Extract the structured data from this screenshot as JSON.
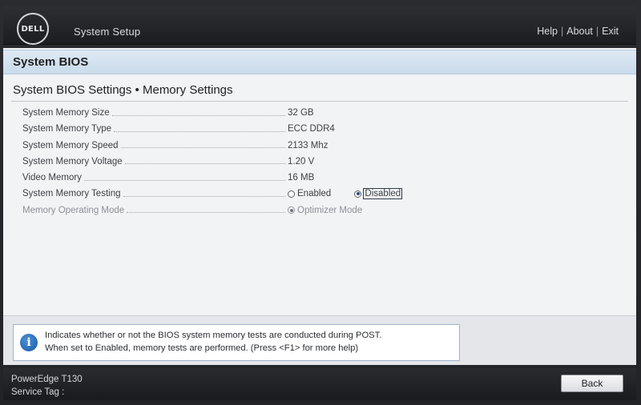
{
  "header": {
    "logo_text": "DELL",
    "app_title": "System Setup",
    "links": {
      "help": "Help",
      "about": "About",
      "exit": "Exit"
    },
    "separator": "|"
  },
  "section": {
    "title": "System BIOS"
  },
  "page": {
    "heading": "System BIOS Settings • Memory Settings"
  },
  "settings": [
    {
      "label": "System Memory Size",
      "value": "32 GB"
    },
    {
      "label": "System Memory Type",
      "value": "ECC DDR4"
    },
    {
      "label": "System Memory Speed",
      "value": "2133 Mhz"
    },
    {
      "label": "System Memory Voltage",
      "value": "1.20 V"
    },
    {
      "label": "Video Memory",
      "value": "16 MB"
    },
    {
      "label": "System Memory Testing",
      "options": [
        {
          "label": "Enabled",
          "selected": false
        },
        {
          "label": "Disabled",
          "selected": true
        }
      ]
    },
    {
      "label": "Memory Operating Mode",
      "options": [
        {
          "label": "Optimizer Mode",
          "selected": true
        }
      ],
      "disabled": true
    }
  ],
  "help": {
    "line1": "Indicates whether or not the BIOS system memory tests are conducted during POST.",
    "line2": "When set to Enabled, memory tests are performed. (Press <F1> for more help)"
  },
  "footer": {
    "model": "PowerEdge T130",
    "service_tag_label": "Service Tag :",
    "back_label": "Back"
  },
  "colors": {
    "section_header": "#c9dbeb",
    "panel_bg": "#f2f3f5",
    "chrome_bg": "#1c1d20",
    "radio_selected": "#1d4c8f"
  }
}
